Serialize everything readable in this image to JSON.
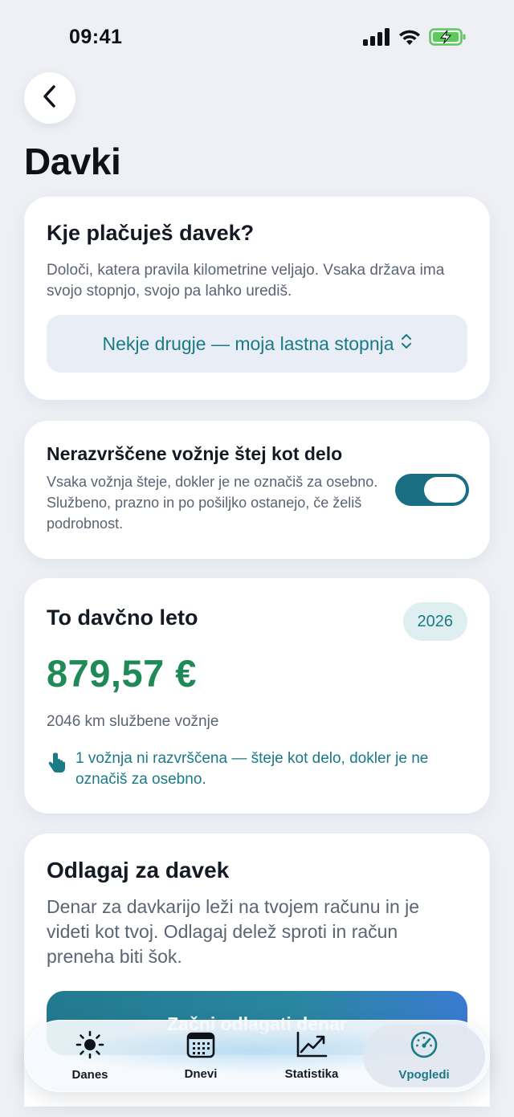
{
  "status_bar": {
    "time": "09:41"
  },
  "header": {
    "back_label": "Back",
    "title": "Davki"
  },
  "country_card": {
    "title": "Kje plačuješ davek?",
    "description": "Določi, katera pravila kilometrine veljajo. Vsaka država ima svojo stopnjo, svojo pa lahko urediš.",
    "selected_option": "Nekje drugje — moja lastna stopnja"
  },
  "toggle_card": {
    "title": "Nerazvrščene vožnje štej kot delo",
    "description": "Vsaka vožnja šteje, dokler je ne označiš za osebno. Službeno, prazno in po pošiljko ostanejo, če želiš podrobnost.",
    "enabled": true
  },
  "year_card": {
    "title": "To davčno leto",
    "year": "2026",
    "amount": "879,57 €",
    "km_text": "2046 km službene vožnje",
    "note": "1 vožnja ni razvrščena — šteje kot delo, dokler je ne označiš za osebno."
  },
  "save_card": {
    "title": "Odlagaj za davek",
    "description": "Denar za davkarijo leži na tvojem računu in je videti kot tvoj. Odlagaj delež sproti in račun preneha biti šok.",
    "button_label": "Začni odlagati denar"
  },
  "tab_bar": {
    "tabs": [
      {
        "label": "Danes",
        "icon": "sun-icon"
      },
      {
        "label": "Dnevi",
        "icon": "calendar-icon"
      },
      {
        "label": "Statistika",
        "icon": "chart-icon"
      },
      {
        "label": "Vpogledi",
        "icon": "gauge-icon"
      }
    ],
    "active_index": 3
  },
  "colors": {
    "accent": "#1a7a86",
    "amount_green": "#1f8a57",
    "toggle_on": "#1a6e82",
    "background": "#eef0f6"
  }
}
